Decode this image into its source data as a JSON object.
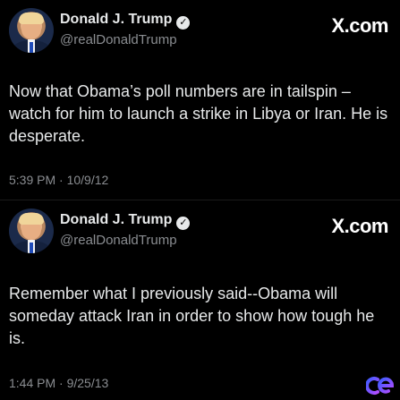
{
  "tweets": [
    {
      "name": "Donald J. Trump",
      "handle": "@realDonaldTrump",
      "site": "X.com",
      "text": "Now that Obama’s poll numbers are in tailspin – watch for him to launch a strike in Libya or Iran.  He is desperate.",
      "timestamp": "5:39 PM · 10/9/12",
      "icons": {
        "avatar": "avatar-photo",
        "verified": "verified-badge-icon"
      }
    },
    {
      "name": "Donald J. Trump",
      "handle": "@realDonaldTrump",
      "site": "X.com",
      "text": "Remember what I previously said--Obama will someday attack Iran in order to show how tough he is.",
      "timestamp": "1:44 PM · 9/25/13",
      "icons": {
        "avatar": "avatar-photo",
        "verified": "verified-badge-icon"
      }
    }
  ],
  "watermark": {
    "icon": "ce-logo-icon"
  },
  "colors": {
    "background": "#000000",
    "text": "#e7e9ea",
    "secondary": "#8a8d91",
    "logo_gradient": [
      "#3b5cff",
      "#b34dff"
    ]
  }
}
